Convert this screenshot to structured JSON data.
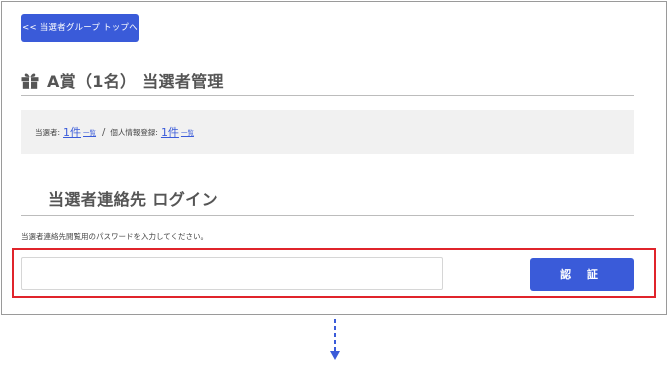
{
  "header": {
    "back_button_label": "<< 当選者グループ トップへ"
  },
  "page": {
    "title": "A賞（1名） 当選者管理",
    "title_icon": "gift-icon"
  },
  "stats": {
    "winners_label": "当選者:",
    "winners_count": "1件",
    "winners_list_link": "一覧",
    "separator": "/",
    "personal_info_label": "個人情報登録:",
    "personal_info_count": "1件",
    "personal_info_list_link": "一覧"
  },
  "login": {
    "title": "当選者連絡先 ログイン",
    "instruction": "当選者連絡先閲覧用のパスワードを入力してください。",
    "password_value": "",
    "password_placeholder": "",
    "submit_label": "認 証"
  },
  "colors": {
    "accent": "#3a5bd9",
    "highlight": "#e0242b"
  }
}
